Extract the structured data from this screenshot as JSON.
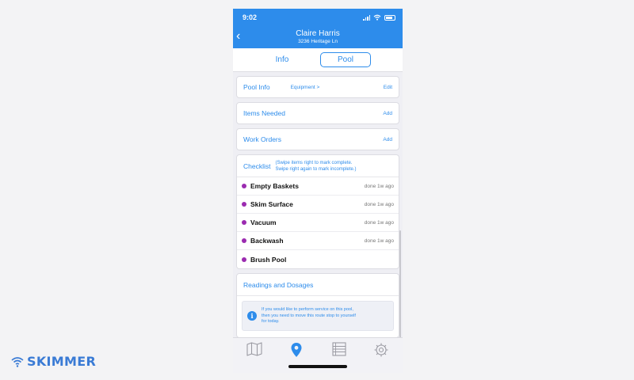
{
  "status_bar": {
    "time": "9:02"
  },
  "header": {
    "title": "Claire Harris",
    "subtitle": "3236 Heritage Ln"
  },
  "segments": {
    "info": "Info",
    "pool": "Pool"
  },
  "cards": {
    "pool_info": {
      "title": "Pool Info",
      "link": "Equipment >",
      "action": "Edit"
    },
    "items_needed": {
      "title": "Items Needed",
      "action": "Add"
    },
    "work_orders": {
      "title": "Work Orders",
      "action": "Add"
    }
  },
  "checklist": {
    "title": "Checklist",
    "hint_line1": "(Swipe items right to mark complete.",
    "hint_line2": "Swipe right again to mark incomplete.)",
    "items": [
      {
        "name": "Empty Baskets",
        "status": "done 1w ago"
      },
      {
        "name": "Skim Surface",
        "status": "done 1w ago"
      },
      {
        "name": "Vacuum",
        "status": "done 1w ago"
      },
      {
        "name": "Backwash",
        "status": "done 1w ago"
      },
      {
        "name": "Brush Pool",
        "status": ""
      }
    ]
  },
  "readings": {
    "title": "Readings and Dosages",
    "info_line1": "If you would like to perform service on this pool,",
    "info_line2": "then you need to move this route stop to yourself",
    "info_line3": "for today."
  },
  "tab_bar": {
    "tabs": [
      {
        "icon": "map-icon"
      },
      {
        "icon": "location-pin-icon"
      },
      {
        "icon": "list-icon"
      },
      {
        "icon": "gear-icon"
      }
    ]
  },
  "brand": {
    "name": "SKIMMER"
  },
  "colors": {
    "accent": "#2d8ceb",
    "dot": "#9b2bb0",
    "brand": "#3a7bd5"
  }
}
